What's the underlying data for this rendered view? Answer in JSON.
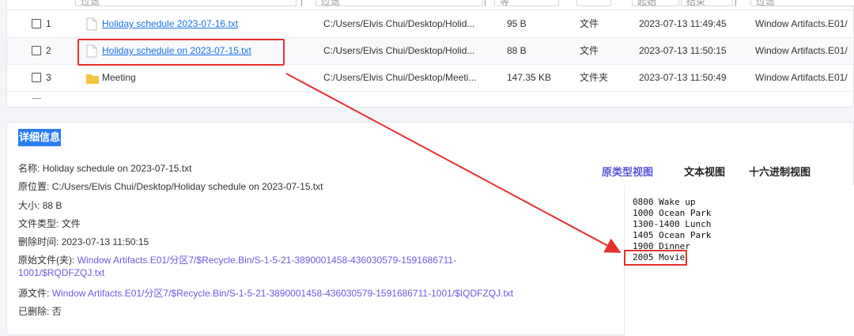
{
  "table": {
    "filter_placeholder": "过滤",
    "rows": [
      {
        "index": "1",
        "name": "Holiday schedule 2023-07-16.txt",
        "is_link": true,
        "path": "C:/Users/Elvis Chui/Desktop/Holid...",
        "size": "95 B",
        "type": "文件",
        "time": "2023-07-13 11:49:45",
        "source": "Window Artifacts.E01/"
      },
      {
        "index": "2",
        "name": "Holiday schedule on 2023-07-15.txt",
        "is_link": true,
        "path": "C:/Users/Elvis Chui/Desktop/Holid...",
        "size": "88 B",
        "type": "文件",
        "time": "2023-07-13 11:50:15",
        "source": "Window Artifacts.E01/"
      },
      {
        "index": "3",
        "name": "Meeting",
        "is_link": false,
        "path": "C:/Users/Elvis Chui/Desktop/Meeti...",
        "size": "147.35 KB",
        "type": "文件夹",
        "time": "2023-07-13 11:50:49",
        "source": "Window Artifacts.E01/"
      }
    ],
    "header_fragments": [
      "过滤",
      "过滤",
      "等",
      "起始",
      "结束",
      "过滤"
    ]
  },
  "details": {
    "title": "详细信息",
    "name_label": "名称:",
    "name_value": "Holiday schedule on 2023-07-15.txt",
    "location_label": "原位置:",
    "location_value": "C:/Users/Elvis Chui/Desktop/Holiday schedule on 2023-07-15.txt",
    "size_label": "大小:",
    "size_value": "88 B",
    "type_label": "文件类型:",
    "type_value": "文件",
    "deleted_time_label": "删除时间:",
    "deleted_time_value": "2023-07-13 11:50:15",
    "original_file_label": "原始文件(夹):",
    "original_file_value_1": "Window Artifacts.E01/分区7/$Recycle.Bin/S-1-5-21-3890001458-436030579-1591686711-",
    "original_file_value_2": "1001/$RQDFZQJ.txt",
    "source_file_label": "源文件:",
    "source_file_value": "Window Artifacts.E01/分区7/$Recycle.Bin/S-1-5-21-3890001458-436030579-1591686711-1001/$IQDFZQJ.txt",
    "deleted_label": "已删除:",
    "deleted_value": "否"
  },
  "tabs": [
    "原类型视图",
    "文本视图",
    "十六进制视图"
  ],
  "preview_lines": [
    "0800 Wake up",
    "1000 Ocean Park",
    "1300-1400 Lunch",
    "1405 Ocean Park",
    "1900 Dinner",
    "2005 Movie"
  ],
  "colors": {
    "link": "#1a73e8",
    "accent": "#2a7ef1",
    "annotation": "#e8312f",
    "purple_link": "#6b5be0"
  }
}
